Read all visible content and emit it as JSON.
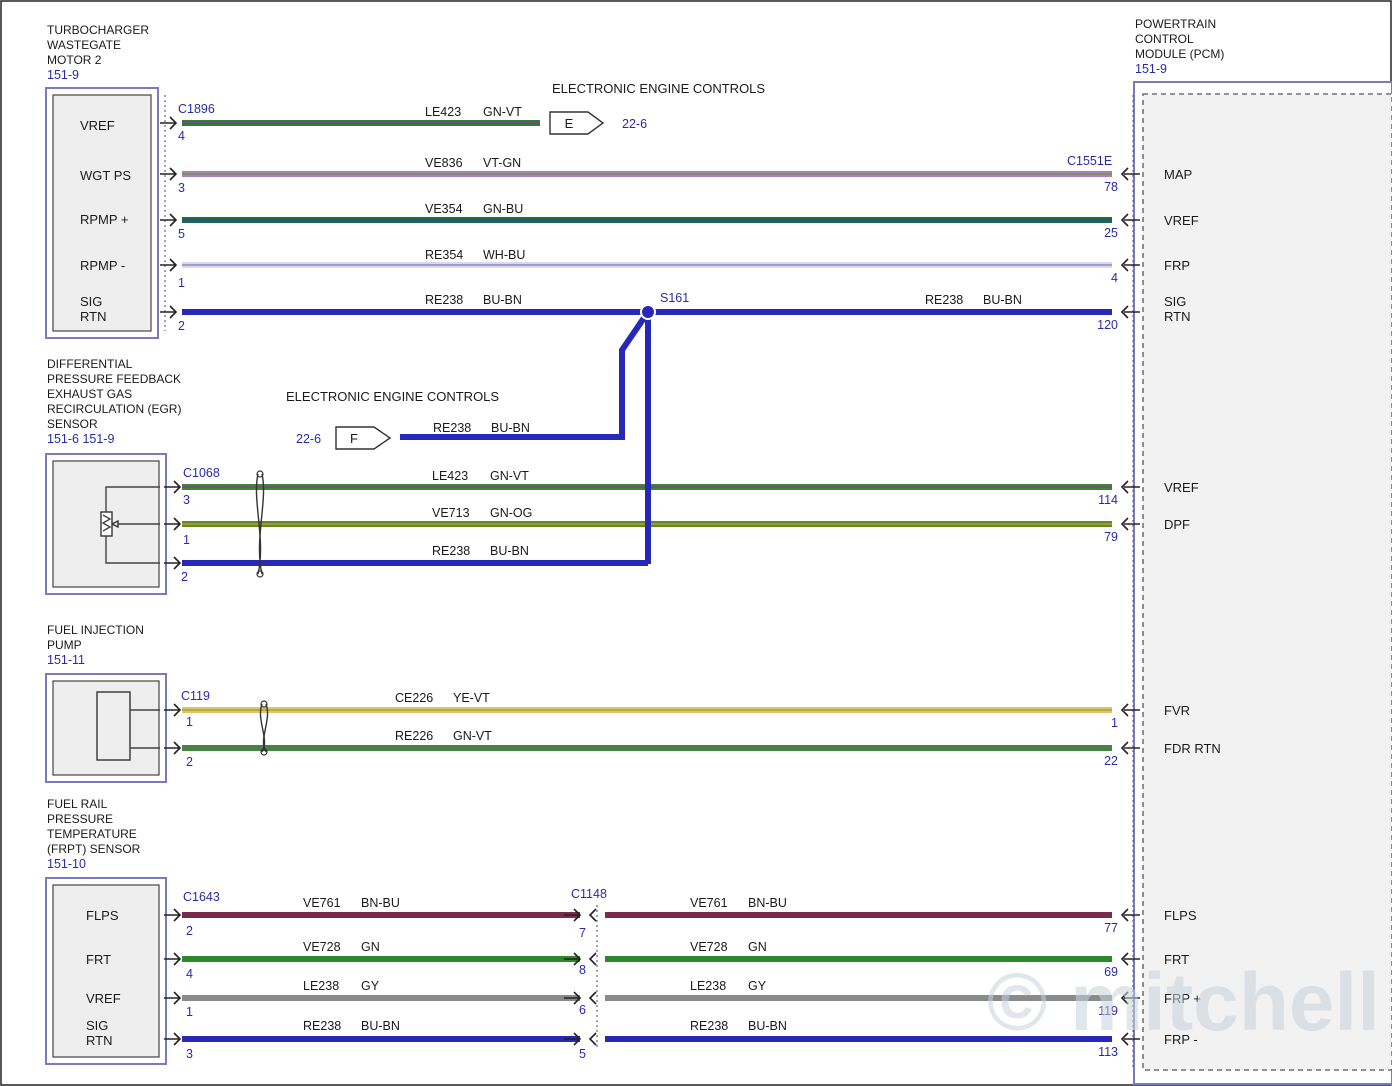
{
  "components": {
    "turbo": {
      "lines": [
        "TURBOCHARGER",
        "WASTEGATE",
        "MOTOR 2"
      ],
      "ref": "151-9",
      "connector": "C1896",
      "pins": [
        {
          "name": "VREF",
          "num": "4"
        },
        {
          "name": "WGT PS",
          "num": "3"
        },
        {
          "name": "RPMP +",
          "num": "5"
        },
        {
          "name": "RPMP -",
          "num": "1"
        },
        {
          "name": "SIG\nRTN",
          "num": "2"
        }
      ]
    },
    "egr": {
      "lines": [
        "DIFFERENTIAL",
        "PRESSURE FEEDBACK",
        "EXHAUST GAS",
        "RECIRCULATION (EGR)",
        "SENSOR"
      ],
      "ref": "151-6  151-9",
      "connector": "C1068",
      "pins": [
        "3",
        "1",
        "2"
      ]
    },
    "fip": {
      "lines": [
        "FUEL INJECTION",
        "PUMP"
      ],
      "ref": "151-11",
      "connector": "C119",
      "pins": [
        "1",
        "2"
      ]
    },
    "frpt": {
      "lines": [
        "FUEL RAIL",
        "PRESSURE",
        "TEMPERATURE",
        "(FRPT) SENSOR"
      ],
      "ref": "151-10",
      "connector": "C1643",
      "pins": [
        {
          "name": "FLPS",
          "num": "2"
        },
        {
          "name": "FRT",
          "num": "4"
        },
        {
          "name": "VREF",
          "num": "1"
        },
        {
          "name": "SIG\nRTN",
          "num": "3"
        }
      ]
    },
    "pcm": {
      "lines": [
        "POWERTRAIN",
        "CONTROL",
        "MODULE (PCM)"
      ],
      "ref": "151-9",
      "connector": "C1551E",
      "pins": [
        {
          "name": "MAP",
          "num": "78"
        },
        {
          "name": "VREF",
          "num": "25"
        },
        {
          "name": "FRP",
          "num": "4"
        },
        {
          "name": "SIG\nRTN",
          "num": "120"
        },
        {
          "name": "VREF",
          "num": "114"
        },
        {
          "name": "DPF",
          "num": "79"
        },
        {
          "name": "FVR",
          "num": "1"
        },
        {
          "name": "FDR RTN",
          "num": "22"
        },
        {
          "name": "FLPS",
          "num": "77"
        },
        {
          "name": "FRT",
          "num": "69"
        },
        {
          "name": "FRP +",
          "num": "119"
        },
        {
          "name": "FRP -",
          "num": "113"
        }
      ]
    }
  },
  "offpage": [
    {
      "title": "ELECTRONIC ENGINE CONTROLS",
      "letter": "E",
      "ref": "22-6"
    },
    {
      "title": "ELECTRONIC ENGINE CONTROLS",
      "letter": "F",
      "ref": "22-6"
    }
  ],
  "splice": "S161",
  "inline_connector": {
    "name": "C1148",
    "pins": [
      "7",
      "8",
      "6",
      "5"
    ]
  },
  "wires": [
    {
      "circuit": "LE423",
      "color": "GN-VT",
      "stripe": [
        "#2e7d32",
        "#7b3f96"
      ]
    },
    {
      "circuit": "VE836",
      "color": "VT-GN",
      "stripe": [
        "#b07cc0",
        "#6a9a4a"
      ]
    },
    {
      "circuit": "VE354",
      "color": "GN-BU",
      "stripe": [
        "#1f6b3a",
        "#2b4aa0"
      ]
    },
    {
      "circuit": "RE354",
      "color": "WH-BU",
      "stripe": [
        "#d8d8ee",
        "#8888c8"
      ]
    },
    {
      "circuit": "RE238",
      "color": "BU-BN",
      "stripe": [
        "#2828b8",
        "#2828b8"
      ]
    },
    {
      "circuit": "RE238",
      "color": "BU-BN",
      "stripe": [
        "#2828b8",
        "#2828b8"
      ]
    },
    {
      "circuit": "RE238",
      "color": "BU-BN",
      "stripe": [
        "#2828b8",
        "#2828b8"
      ]
    },
    {
      "circuit": "LE423",
      "color": "GN-VT",
      "stripe": [
        "#3d8a2e",
        "#7b3f96"
      ]
    },
    {
      "circuit": "VE713",
      "color": "GN-OG",
      "stripe": [
        "#5a8a2a",
        "#c89a2a"
      ]
    },
    {
      "circuit": "RE238",
      "color": "BU-BN",
      "stripe": [
        "#2828b8",
        "#2828b8"
      ]
    },
    {
      "circuit": "CE226",
      "color": "YE-VT",
      "stripe": [
        "#d9c86a",
        "#b69a3a"
      ]
    },
    {
      "circuit": "RE226",
      "color": "GN-VT",
      "stripe": [
        "#3d8a3a",
        "#6a6a6a"
      ]
    },
    {
      "circuit": "VE761",
      "color": "BN-BU",
      "stripe": [
        "#7a2a4a",
        "#7a2a4a"
      ]
    },
    {
      "circuit": "VE728",
      "color": "GN",
      "stripe": [
        "#2a8a2a",
        "#2a8a2a"
      ]
    },
    {
      "circuit": "LE238",
      "color": "GY",
      "stripe": [
        "#8a8a8a",
        "#8a8a8a"
      ]
    },
    {
      "circuit": "RE238",
      "color": "BU-BN",
      "stripe": [
        "#2828b8",
        "#2828b8"
      ]
    }
  ],
  "watermark": "© mitchell"
}
